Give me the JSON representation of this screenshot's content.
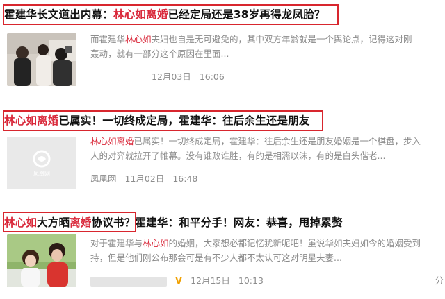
{
  "results": [
    {
      "title_pre": "霍建华长文道出内幕：",
      "title_kw": "林心如离婚",
      "title_post": "已经定局还是38岁再得龙凤胎？",
      "snippet_line1_pre": "而霍建华",
      "snippet_line1_kw": "林心如",
      "snippet_line1_post": "夫妇也自是无可避免的，其中双方年龄就是一个舆论点，记得这对刚",
      "snippet_line2": "轰动，就有一部分这个原因在里面...",
      "date": "12月03日",
      "time": "16:06"
    },
    {
      "title_kw": "林心如离婚",
      "title_post": "已属实！一切终成定局，霍建华：往后余生还是朋友",
      "snippet_line1_kw": "林心如离婚",
      "snippet_line1_post": "已属实！一切终成定局，霍建华：往后余生还是朋友婚姻是一个棋盘，步入",
      "snippet_line2": "人的对弈就拉开了帷幕。没有谁败谁胜，有的是相濡以沫，有的是白头偕老...",
      "source": "凤凰网",
      "date": "11月02日",
      "time": "16:48",
      "thumb_label": "凤凰网"
    },
    {
      "title_kw1": "林心如",
      "title_mid": "大方晒",
      "title_kw2": "离婚",
      "title_post1": "协议书？",
      "title_post2": "霍建华：和平分手！网友：恭喜，甩掉累赘",
      "snippet_line1_pre": "对于霍建华与",
      "snippet_line1_kw": "林心如",
      "snippet_line1_post": "的婚姻，大家想必都记忆犹新呢吧！虽说华如夫妇如今的婚姻受到",
      "snippet_line2": "持，但是他们刚公布那会可是有不少人都不太认可这对明星夫妻...",
      "verified_badge": "V",
      "date": "12月15日",
      "time": "10:13",
      "partial_right": "分"
    }
  ],
  "colors": {
    "keyword": "#d9283a",
    "highlight_box": "#d8262e",
    "meta_text": "#8c8c8c",
    "badge": "#f0a000"
  }
}
